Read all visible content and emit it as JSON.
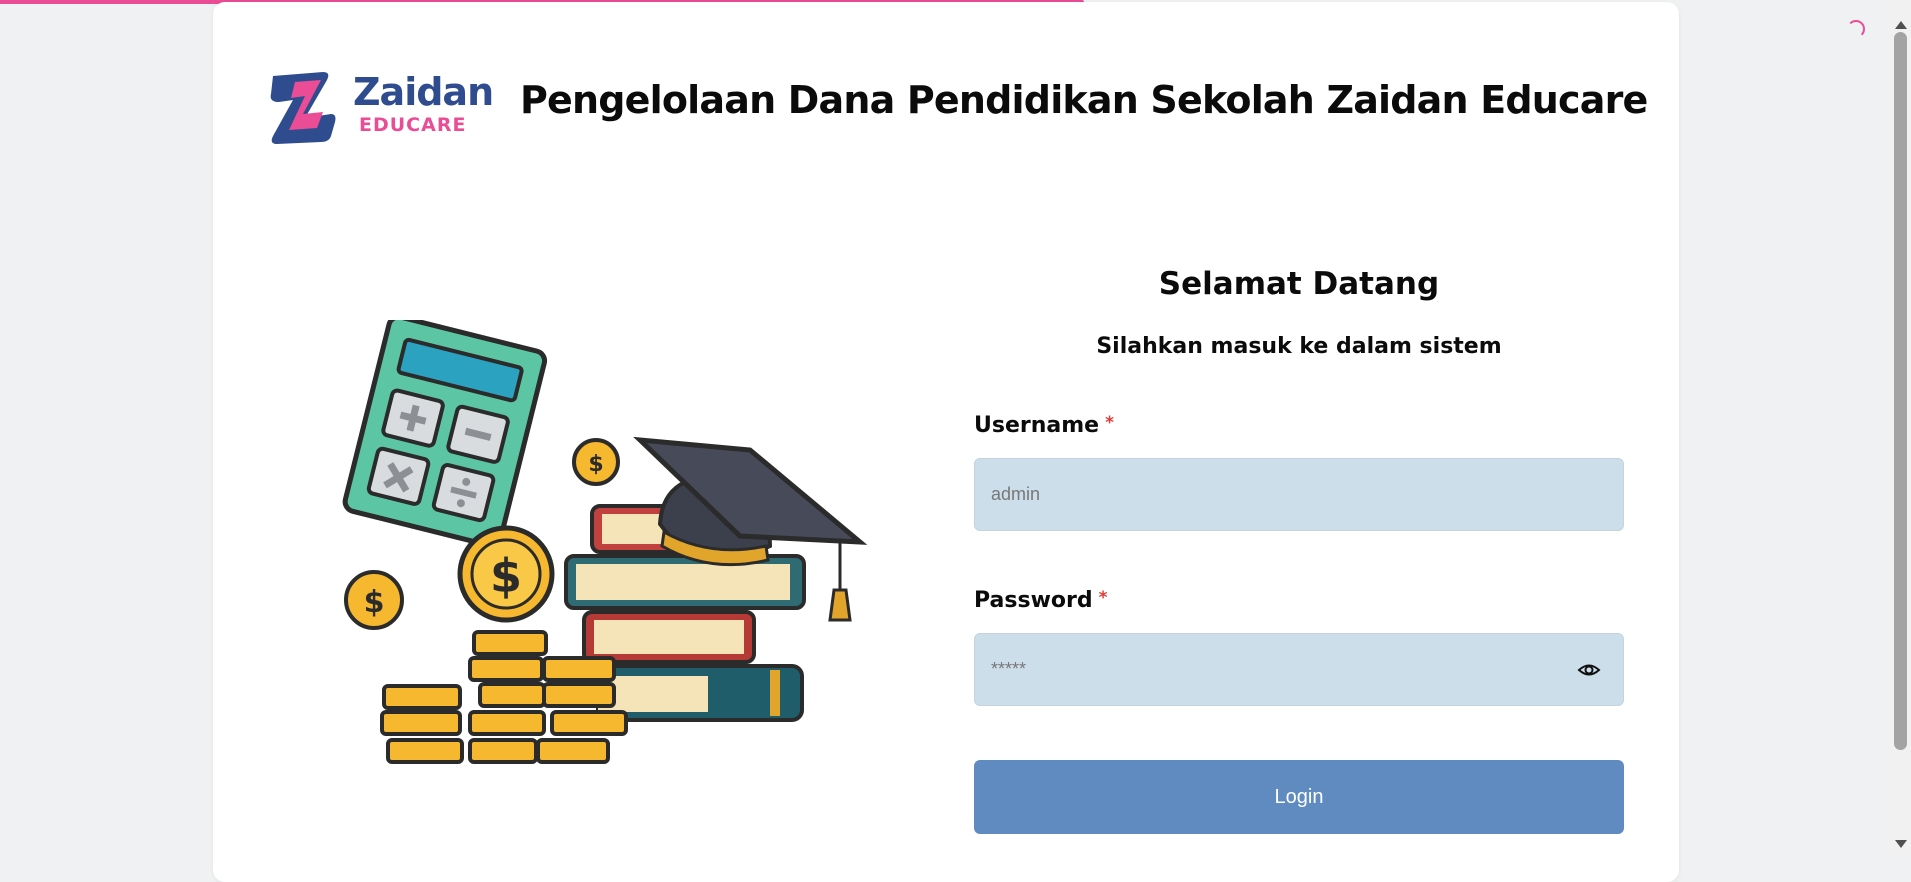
{
  "header": {
    "logo_name": "Zaidan",
    "logo_tagline": "EDUCARE",
    "title": "Pengelolaan Dana Pendidikan Sekolah Zaidan Educare"
  },
  "login": {
    "welcome": "Selamat Datang",
    "subtitle": "Silahkan masuk ke dalam sistem",
    "username_label": "Username",
    "username_placeholder": "admin",
    "password_label": "Password",
    "password_placeholder": "*****",
    "required_mark": "*",
    "submit_label": "Login"
  },
  "icons": {
    "password_toggle": "eye-icon",
    "loading": "spinner-icon",
    "illustration": "education-finance-illustration"
  },
  "colors": {
    "brand_blue": "#2f4d8e",
    "brand_pink": "#ea4c96",
    "input_bg": "#cddeeb",
    "button_bg": "#608bc1",
    "required": "#e53935"
  }
}
